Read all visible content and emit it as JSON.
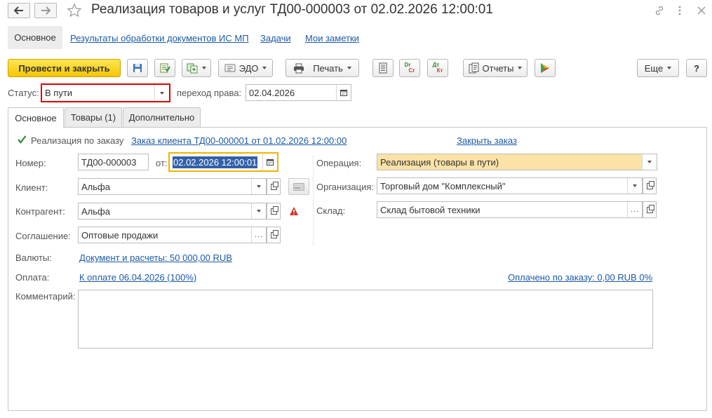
{
  "window": {
    "title": "Реализация товаров и услуг ТД00-000003 от 02.02.2026 12:00:01",
    "back_icon": "arrow-left-icon",
    "forward_icon": "arrow-right-icon",
    "favorite_icon": "star-icon",
    "link_icon": "link-icon",
    "menu_icon": "more-vertical-icon",
    "close_icon": "close-icon"
  },
  "nav_tabs": {
    "main": "Основное",
    "ismp": "Результаты обработки документов ИС МП",
    "tasks": "Задачи",
    "notes": "Мои заметки"
  },
  "toolbar": {
    "post_close": "Провести и закрыть",
    "edo": "ЭДО",
    "print": "Печать",
    "reports": "Отчеты",
    "more": "Еще",
    "help": "?",
    "dr_cr_top": "Dr",
    "dr_cr_bottom": "Cr",
    "dt_kt_top": "Дт",
    "dt_kt_bottom": "Кт"
  },
  "status": {
    "label": "Статус:",
    "value": "В пути",
    "transfer_label": "переход права:",
    "transfer_date": "02.04.2026"
  },
  "form_tabs": {
    "main": "Основное",
    "goods": "Товары (1)",
    "extra": "Дополнительно"
  },
  "form": {
    "by_order_label": "Реализация по заказу",
    "by_order_checked": true,
    "order_link": "Заказ клиента ТД00-000001 от 01.02.2026 12:00:00",
    "close_order": "Закрыть заказ",
    "number_label": "Номер:",
    "number": "ТД00-000003",
    "from_label": "от:",
    "date": "02.02.2026 12:00:01",
    "client_label": "Клиент:",
    "client": "Альфа",
    "contractor_label": "Контрагент:",
    "contractor": "Альфа",
    "agreement_label": "Соглашение:",
    "agreement": "Оптовые продажи",
    "operation_label": "Операция:",
    "operation": "Реализация (товары в пути)",
    "organization_label": "Организация:",
    "organization": "Торговый дом \"Комплексный\"",
    "warehouse_label": "Склад:",
    "warehouse": "Склад бытовой техники",
    "currency_label": "Валюты:",
    "currency_link": "Документ и расчеты: 50 000,00 RUB",
    "payment_label": "Оплата:",
    "payment_link": "К оплате 06.04.2026 (100%)",
    "paid_link": "Оплачено по заказу: 0,00 RUB 0%",
    "comment_label": "Комментарий:",
    "comment": ""
  },
  "colors": {
    "primary_button": "#f5c500",
    "link": "#1a5aa6",
    "operation_bg": "#fbe3a7",
    "status_border": "#e00000",
    "date_focus": "#f0b400",
    "warning": "#d9312b"
  }
}
